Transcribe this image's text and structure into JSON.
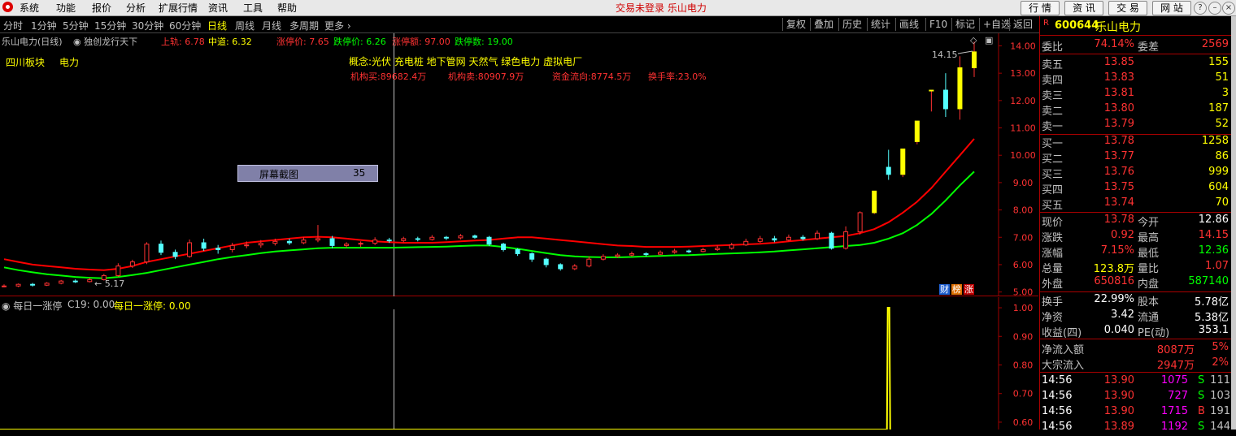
{
  "app": {
    "status_title": "交易未登录  乐山电力"
  },
  "menu": [
    "系统",
    "功能",
    "报价",
    "分析",
    "扩展行情",
    "资讯",
    "工具",
    "帮助"
  ],
  "top_buttons": [
    "行 情",
    "资 讯",
    "交 易",
    "网 站"
  ],
  "window_buttons": [
    "?",
    "–",
    "×"
  ],
  "toolbar": {
    "periods": [
      "分时",
      "1分钟",
      "5分钟",
      "15分钟",
      "30分钟",
      "60分钟",
      "日线",
      "周线",
      "月线",
      "多周期",
      "更多 ›"
    ],
    "active": "日线",
    "right": [
      "复权",
      "叠加",
      "历史",
      "统计",
      "画线",
      "F10",
      "标记",
      "+自选",
      "返回"
    ]
  },
  "header": {
    "name": "乐山电力(日线)",
    "indicator": "独创龙行天下",
    "upper_label": "上轨: 6.78",
    "mid_label": "中道: 6.32",
    "limit_up_price": "涨停价: 7.65",
    "limit_down_price": "跌停价: 6.26",
    "limit_amount": "涨停额: 97.00",
    "limit_count": "跌停数: 19.00"
  },
  "sector": {
    "board": "四川板块",
    "industry": "电力"
  },
  "concepts": "概念:光伏 充电桩 地下管网 天然气 绿色电力 虚拟电厂",
  "fund": {
    "inst_buy": "机构买:89682.4万",
    "inst_sell": "机构卖:80907.9万",
    "flow": "资金流向:8774.5万",
    "turnover": "换手率:23.0%"
  },
  "popup": {
    "label": "屏幕截图",
    "value": "35"
  },
  "chart_labels": {
    "high": "14.15",
    "low": "5.17"
  },
  "badges": [
    "财",
    "榜",
    "涨"
  ],
  "sub": {
    "title": "每日一涨停",
    "c19": "C19: 0.00",
    "series_label": "每日一涨停: 0.00"
  },
  "colors": {
    "up": "#ff3232",
    "down": "#54ffff",
    "upper_line": "#ff0000",
    "lower_line": "#00ff00",
    "signal": "#ffff00"
  },
  "chart_data": [
    {
      "type": "candlestick",
      "title": "乐山电力(日线)",
      "y_ticks": [
        5.0,
        6.0,
        7.0,
        8.0,
        9.0,
        10.0,
        11.0,
        12.0,
        13.0,
        14.0
      ],
      "ylim": [
        4.9,
        14.4
      ],
      "candles": [
        [
          5.2,
          5.22,
          5.28,
          5.17
        ],
        [
          5.22,
          5.28,
          5.31,
          5.18
        ],
        [
          5.28,
          5.25,
          5.33,
          5.2
        ],
        [
          5.25,
          5.32,
          5.36,
          5.22
        ],
        [
          5.32,
          5.4,
          5.44,
          5.28
        ],
        [
          5.4,
          5.38,
          5.46,
          5.33
        ],
        [
          5.38,
          5.45,
          5.52,
          5.35
        ],
        [
          5.45,
          5.6,
          5.66,
          5.42
        ],
        [
          5.6,
          5.95,
          6.05,
          5.55
        ],
        [
          5.95,
          6.1,
          6.18,
          5.88
        ],
        [
          6.1,
          6.75,
          6.82,
          6.02
        ],
        [
          6.75,
          6.45,
          6.88,
          6.35
        ],
        [
          6.45,
          6.3,
          6.55,
          6.2
        ],
        [
          6.3,
          6.8,
          6.92,
          6.25
        ],
        [
          6.8,
          6.6,
          6.95,
          6.5
        ],
        [
          6.6,
          6.55,
          6.72,
          6.4
        ],
        [
          6.55,
          6.7,
          6.8,
          6.45
        ],
        [
          6.7,
          6.72,
          6.85,
          6.6
        ],
        [
          6.72,
          6.78,
          6.9,
          6.62
        ],
        [
          6.78,
          6.85,
          6.95,
          6.7
        ],
        [
          6.85,
          6.8,
          6.95,
          6.72
        ],
        [
          6.8,
          6.9,
          7.0,
          6.75
        ],
        [
          6.9,
          6.95,
          7.45,
          6.82
        ],
        [
          6.95,
          6.7,
          7.05,
          6.6
        ],
        [
          6.7,
          6.75,
          6.82,
          6.62
        ],
        [
          6.75,
          6.78,
          6.85,
          6.65
        ],
        [
          6.78,
          6.9,
          7.0,
          6.72
        ],
        [
          6.9,
          6.88,
          6.98,
          6.8
        ],
        [
          6.88,
          6.95,
          7.02,
          6.82
        ],
        [
          6.95,
          6.92,
          7.02,
          6.85
        ],
        [
          6.92,
          7.0,
          7.08,
          6.88
        ],
        [
          7.0,
          6.98,
          7.05,
          6.9
        ],
        [
          6.98,
          7.05,
          7.12,
          6.92
        ],
        [
          7.05,
          7.0,
          7.1,
          6.95
        ],
        [
          7.0,
          6.75,
          7.05,
          6.68
        ],
        [
          6.75,
          6.55,
          6.8,
          6.48
        ],
        [
          6.55,
          6.4,
          6.6,
          6.32
        ],
        [
          6.4,
          6.2,
          6.45,
          6.1
        ],
        [
          6.2,
          6.0,
          6.25,
          5.9
        ],
        [
          6.0,
          5.85,
          6.05,
          5.78
        ],
        [
          5.85,
          5.95,
          6.02,
          5.8
        ],
        [
          5.95,
          6.2,
          6.3,
          5.9
        ],
        [
          6.2,
          6.3,
          6.38,
          6.15
        ],
        [
          6.3,
          6.35,
          6.42,
          6.25
        ],
        [
          6.35,
          6.4,
          6.48,
          6.3
        ],
        [
          6.4,
          6.38,
          6.45,
          6.3
        ],
        [
          6.38,
          6.45,
          6.52,
          6.35
        ],
        [
          6.45,
          6.5,
          6.58,
          6.4
        ],
        [
          6.5,
          6.48,
          6.55,
          6.42
        ],
        [
          6.48,
          6.55,
          6.62,
          6.45
        ],
        [
          6.55,
          6.6,
          6.7,
          6.5
        ],
        [
          6.6,
          6.72,
          6.8,
          6.55
        ],
        [
          6.72,
          6.85,
          6.95,
          6.68
        ],
        [
          6.85,
          6.95,
          7.05,
          6.8
        ],
        [
          6.95,
          6.9,
          7.05,
          6.82
        ],
        [
          6.9,
          7.0,
          7.1,
          6.85
        ],
        [
          7.0,
          6.95,
          7.08,
          6.88
        ],
        [
          6.95,
          7.15,
          7.25,
          6.9
        ],
        [
          7.15,
          6.6,
          7.2,
          6.55
        ],
        [
          6.6,
          7.2,
          7.4,
          6.55
        ],
        [
          7.2,
          7.9,
          7.95,
          7.1
        ],
        [
          7.9,
          8.69,
          8.69,
          7.85
        ],
        [
          9.56,
          9.3,
          10.2,
          9.1
        ],
        [
          9.3,
          10.23,
          10.23,
          9.2
        ],
        [
          10.5,
          11.25,
          11.25,
          10.4
        ],
        [
          12.38,
          12.38,
          12.38,
          11.6
        ],
        [
          12.38,
          11.7,
          13.0,
          11.4
        ],
        [
          11.7,
          13.2,
          13.62,
          11.3
        ],
        [
          13.2,
          13.78,
          14.15,
          12.86
        ]
      ],
      "upper_band": [
        6.2,
        6.1,
        6.0,
        5.95,
        5.9,
        5.85,
        5.82,
        5.8,
        5.85,
        5.95,
        6.1,
        6.2,
        6.3,
        6.4,
        6.5,
        6.6,
        6.7,
        6.8,
        6.85,
        6.9,
        6.95,
        7.0,
        7.02,
        7.0,
        6.95,
        6.9,
        6.85,
        6.82,
        6.8,
        6.8,
        6.8,
        6.82,
        6.85,
        6.88,
        6.9,
        6.95,
        7.0,
        7.0,
        6.95,
        6.9,
        6.85,
        6.8,
        6.75,
        6.7,
        6.68,
        6.65,
        6.65,
        6.65,
        6.66,
        6.68,
        6.7,
        6.72,
        6.74,
        6.76,
        6.8,
        6.85,
        6.9,
        6.95,
        7.0,
        7.05,
        7.15,
        7.3,
        7.55,
        7.9,
        8.3,
        8.8,
        9.4,
        10.0,
        10.6
      ],
      "lower_band": [
        5.9,
        5.8,
        5.72,
        5.65,
        5.6,
        5.55,
        5.52,
        5.5,
        5.55,
        5.62,
        5.7,
        5.8,
        5.9,
        6.0,
        6.1,
        6.2,
        6.28,
        6.35,
        6.42,
        6.48,
        6.52,
        6.56,
        6.6,
        6.62,
        6.62,
        6.62,
        6.62,
        6.62,
        6.63,
        6.64,
        6.65,
        6.66,
        6.68,
        6.7,
        6.7,
        6.65,
        6.58,
        6.5,
        6.42,
        6.35,
        6.3,
        6.28,
        6.27,
        6.27,
        6.28,
        6.3,
        6.32,
        6.34,
        6.35,
        6.37,
        6.39,
        6.41,
        6.43,
        6.45,
        6.48,
        6.52,
        6.56,
        6.6,
        6.64,
        6.68,
        6.72,
        6.8,
        6.95,
        7.15,
        7.45,
        7.85,
        8.35,
        8.9,
        9.4
      ]
    },
    {
      "type": "bar",
      "title": "每日一涨停",
      "y_ticks": [
        1.0,
        0.9,
        0.8,
        0.7,
        0.6
      ],
      "ylim": [
        0.58,
        1.02
      ],
      "signal_at_index": 62,
      "values": [
        0,
        0,
        0,
        0,
        0,
        0,
        0,
        0,
        0,
        0,
        0,
        0,
        0,
        0,
        0,
        0,
        0,
        0,
        0,
        0,
        0,
        0,
        0,
        0,
        0,
        0,
        0,
        0,
        0,
        0,
        0,
        0,
        0,
        0,
        0,
        0,
        0,
        0,
        0,
        0,
        0,
        0,
        0,
        0,
        0,
        0,
        0,
        0,
        0,
        0,
        0,
        0,
        0,
        0,
        0,
        0,
        0,
        0,
        0,
        0,
        0,
        0,
        1,
        0,
        0,
        0,
        0,
        0,
        0
      ]
    }
  ],
  "quote": {
    "code": "600644",
    "name": "乐山电力",
    "ratio_label": "委比",
    "ratio_val": "74.14%",
    "diff_label": "委差",
    "diff_val": "2569",
    "asks": [
      {
        "label": "卖五",
        "price": "13.85",
        "vol": "155"
      },
      {
        "label": "卖四",
        "price": "13.83",
        "vol": "51"
      },
      {
        "label": "卖三",
        "price": "13.81",
        "vol": "3"
      },
      {
        "label": "卖二",
        "price": "13.80",
        "vol": "187"
      },
      {
        "label": "卖一",
        "price": "13.79",
        "vol": "52"
      }
    ],
    "bids": [
      {
        "label": "买一",
        "price": "13.78",
        "vol": "1258"
      },
      {
        "label": "买二",
        "price": "13.77",
        "vol": "86"
      },
      {
        "label": "买三",
        "price": "13.76",
        "vol": "999"
      },
      {
        "label": "买四",
        "price": "13.75",
        "vol": "604"
      },
      {
        "label": "买五",
        "price": "13.74",
        "vol": "70"
      }
    ],
    "stats": [
      {
        "l1": "现价",
        "v1": "13.78",
        "c1": "#ff3232",
        "l2": "今开",
        "v2": "12.86",
        "c2": "#ffffff"
      },
      {
        "l1": "涨跌",
        "v1": "0.92",
        "c1": "#ff3232",
        "l2": "最高",
        "v2": "14.15",
        "c2": "#ff3232"
      },
      {
        "l1": "涨幅",
        "v1": "7.15%",
        "c1": "#ff3232",
        "l2": "最低",
        "v2": "12.36",
        "c2": "#00ff00"
      },
      {
        "l1": "总量",
        "v1": "123.8万",
        "c1": "#ffff00",
        "l2": "量比",
        "v2": "1.07",
        "c2": "#ff3232"
      },
      {
        "l1": "外盘",
        "v1": "650816",
        "c1": "#ff3232",
        "l2": "内盘",
        "v2": "587140",
        "c2": "#00ff00"
      }
    ],
    "stats2": [
      {
        "l1": "换手",
        "v1": "22.99%",
        "l2": "股本",
        "v2": "5.78亿"
      },
      {
        "l1": "净资",
        "v1": "3.42",
        "l2": "流通",
        "v2": "5.38亿"
      },
      {
        "l1": "收益(四)",
        "v1": "0.040",
        "l2": "PE(动)",
        "v2": "353.1"
      }
    ],
    "flows": [
      {
        "label": "净流入额",
        "val": "8087万",
        "pct": "5%"
      },
      {
        "label": "大宗流入",
        "val": "2947万",
        "pct": "2%"
      }
    ],
    "ticks": [
      {
        "time": "14:56",
        "price": "13.90",
        "vol": "1075",
        "side": "S",
        "cnt": "111",
        "vc": "#ff00ff",
        "sc": "#00ff00"
      },
      {
        "time": "14:56",
        "price": "13.90",
        "vol": "727",
        "side": "S",
        "cnt": "103",
        "vc": "#ff00ff",
        "sc": "#00ff00"
      },
      {
        "time": "14:56",
        "price": "13.90",
        "vol": "1715",
        "side": "B",
        "cnt": "191",
        "vc": "#ff00ff",
        "sc": "#ff3232"
      },
      {
        "time": "14:56",
        "price": "13.89",
        "vol": "1192",
        "side": "S",
        "cnt": "144",
        "vc": "#ff00ff",
        "sc": "#00ff00"
      }
    ]
  }
}
